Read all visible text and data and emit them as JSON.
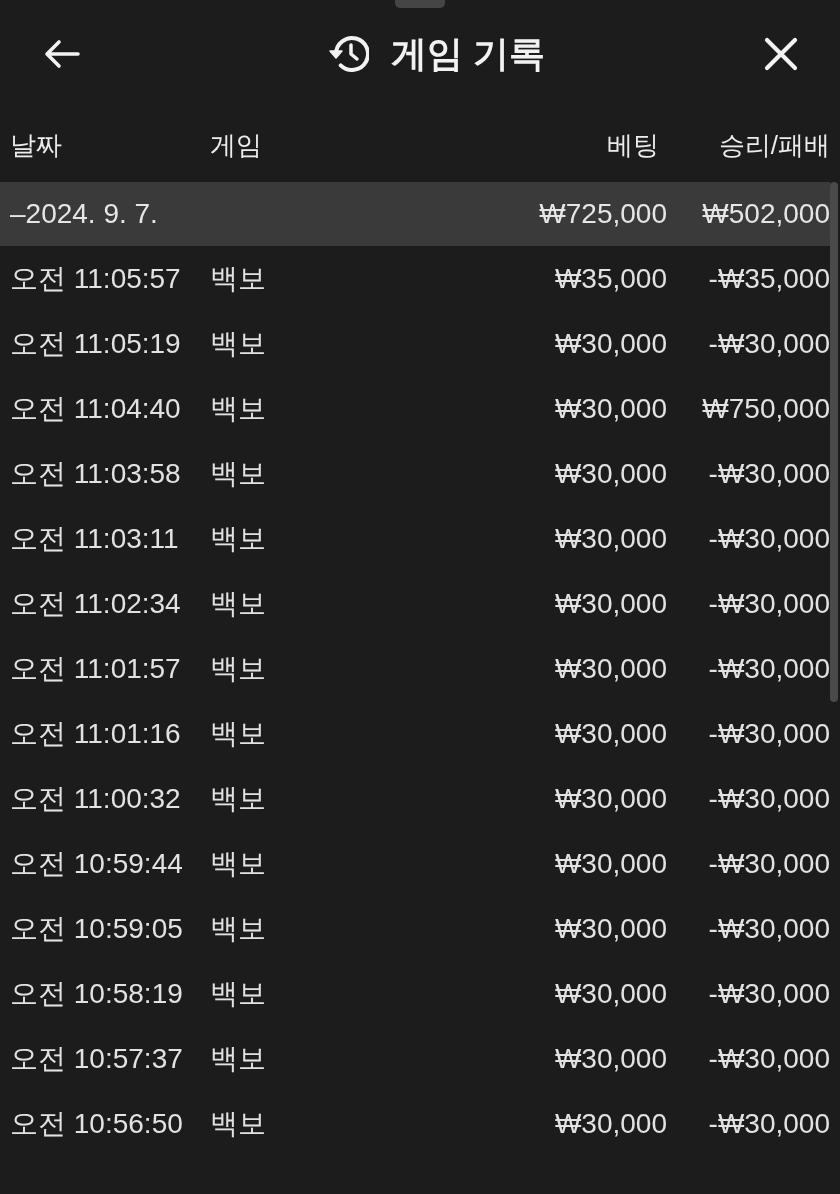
{
  "header": {
    "title": "게임 기록"
  },
  "columns": [
    "날짜",
    "게임",
    "베팅",
    "승리/패배"
  ],
  "groups": [
    {
      "date": "–2024. 9. 7.",
      "bet": "₩725,000",
      "result": "₩502,000",
      "rows": [
        {
          "time": "오전 11:05:57",
          "game": "백보",
          "bet": "₩35,000",
          "result": "-₩35,000"
        },
        {
          "time": "오전 11:05:19",
          "game": "백보",
          "bet": "₩30,000",
          "result": "-₩30,000"
        },
        {
          "time": "오전 11:04:40",
          "game": "백보",
          "bet": "₩30,000",
          "result": "₩750,000"
        },
        {
          "time": "오전 11:03:58",
          "game": "백보",
          "bet": "₩30,000",
          "result": "-₩30,000"
        },
        {
          "time": "오전 11:03:11",
          "game": "백보",
          "bet": "₩30,000",
          "result": "-₩30,000"
        },
        {
          "time": "오전 11:02:34",
          "game": "백보",
          "bet": "₩30,000",
          "result": "-₩30,000"
        },
        {
          "time": "오전 11:01:57",
          "game": "백보",
          "bet": "₩30,000",
          "result": "-₩30,000"
        },
        {
          "time": "오전 11:01:16",
          "game": "백보",
          "bet": "₩30,000",
          "result": "-₩30,000"
        },
        {
          "time": "오전 11:00:32",
          "game": "백보",
          "bet": "₩30,000",
          "result": "-₩30,000"
        },
        {
          "time": "오전 10:59:44",
          "game": "백보",
          "bet": "₩30,000",
          "result": "-₩30,000"
        },
        {
          "time": "오전 10:59:05",
          "game": "백보",
          "bet": "₩30,000",
          "result": "-₩30,000"
        },
        {
          "time": "오전 10:58:19",
          "game": "백보",
          "bet": "₩30,000",
          "result": "-₩30,000"
        },
        {
          "time": "오전 10:57:37",
          "game": "백보",
          "bet": "₩30,000",
          "result": "-₩30,000"
        },
        {
          "time": "오전 10:56:50",
          "game": "백보",
          "bet": "₩30,000",
          "result": "-₩30,000"
        }
      ]
    }
  ]
}
